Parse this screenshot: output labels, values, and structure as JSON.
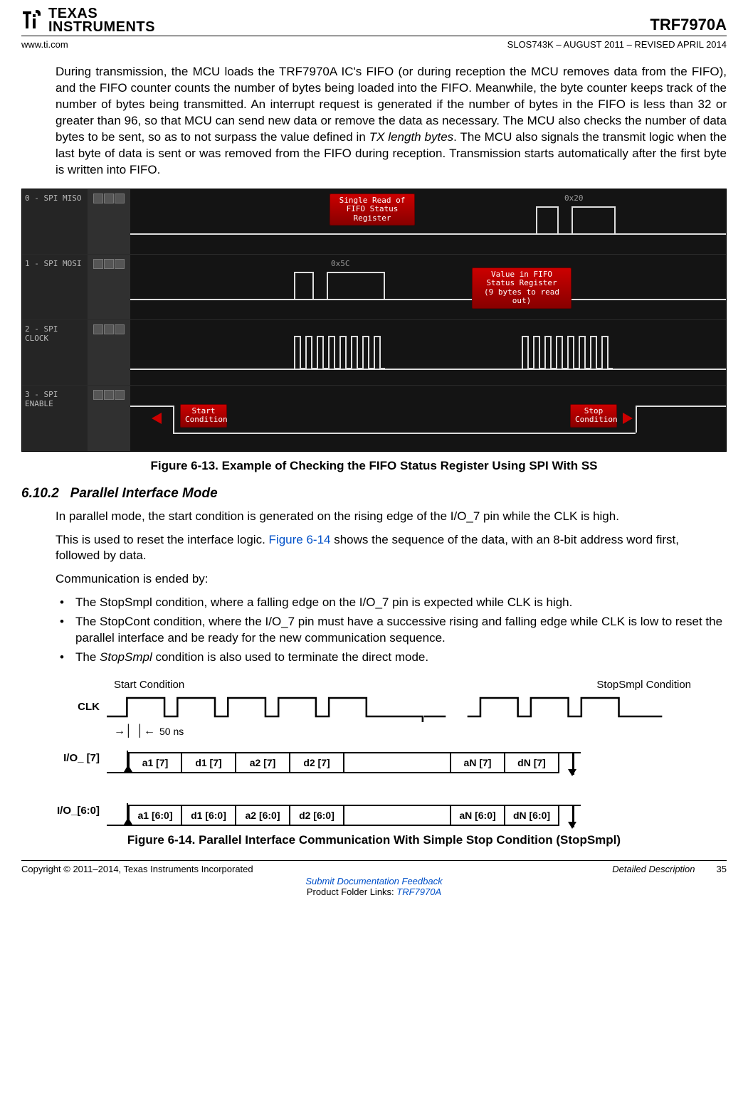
{
  "header": {
    "logo_text1": "TEXAS",
    "logo_text2": "INSTRUMENTS",
    "part": "TRF7970A",
    "url": "www.ti.com",
    "docid": "SLOS743K – AUGUST 2011 – REVISED APRIL 2014"
  },
  "body": {
    "para1": "During transmission, the MCU loads the TRF7970A IC's FIFO (or during reception the MCU removes data from the FIFO), and the FIFO counter counts the number of bytes being loaded into the FIFO. Meanwhile, the byte counter keeps track of the number of bytes being transmitted. An interrupt request is generated if the number of bytes in the FIFO is less than 32 or greater than 96, so that MCU can send new data or remove the data as necessary. The MCU also checks the number of data bytes to be sent, so as to not surpass the value defined in ",
    "para1_em": "TX length bytes",
    "para1_b": ". The MCU also signals the transmit logic when the last byte of data is sent or was removed from the FIFO during reception. Transmission starts automatically after the first byte is written into FIFO."
  },
  "fig613": {
    "caption": "Figure 6-13. Example of Checking the FIFO Status Register Using SPI With SS",
    "rows": [
      "0 - SPI MISO",
      "1 - SPI MOSI",
      "2 - SPI CLOCK",
      "3 - SPI ENABLE"
    ],
    "tag1": "Single Read of FIFO Status Register",
    "hex1": "0x20",
    "hex2": "0x5C",
    "tag2a": "Value in FIFO Status Register",
    "tag2b": "(9 bytes to read out)",
    "tag3": "Start Condition",
    "tag4": "Stop Condition"
  },
  "sec": {
    "num": "6.10.2",
    "title": "Parallel Interface Mode",
    "p1": "In parallel mode, the start condition is generated on the rising edge of the I/O_7 pin while the CLK is high.",
    "p2a": "This is used to reset the interface logic. ",
    "p2link": "Figure 6-14",
    "p2b": " shows the sequence of the data, with an 8-bit address word first, followed by data.",
    "p3": "Communication is ended by:",
    "b1": "The StopSmpl condition, where a falling edge on the I/O_7 pin is expected while CLK is high.",
    "b2": "The StopCont condition, where the I/O_7 pin must have a successive rising and falling edge while CLK is low to reset the parallel interface and be ready for the new communication sequence.",
    "b3a": "The ",
    "b3em": "StopSmpl",
    "b3b": " condition is also used to terminate the direct mode."
  },
  "fig614": {
    "caption": "Figure 6-14. Parallel Interface Communication With Simple Stop Condition (StopSmpl)",
    "start": "Start Condition",
    "stop": "StopSmpl Condition",
    "delay": "50 ns",
    "clk": "CLK",
    "io7": "I/O_ [7]",
    "io60": "I/O_[6:0]",
    "seq7": [
      "a1 [7]",
      "d1 [7]",
      "a2 [7]",
      "d2 [7]",
      "aN [7]",
      "dN [7]"
    ],
    "seq60": [
      "a1 [6:0]",
      "d1 [6:0]",
      "a2 [6:0]",
      "d2 [6:0]",
      "aN [6:0]",
      "dN [6:0]"
    ]
  },
  "footer": {
    "copyright": "Copyright © 2011–2014, Texas Instruments Incorporated",
    "section": "Detailed Description",
    "pageno": "35",
    "link1": "Submit Documentation Feedback",
    "link2_prefix": "Product Folder Links: ",
    "link2": "TRF7970A"
  }
}
